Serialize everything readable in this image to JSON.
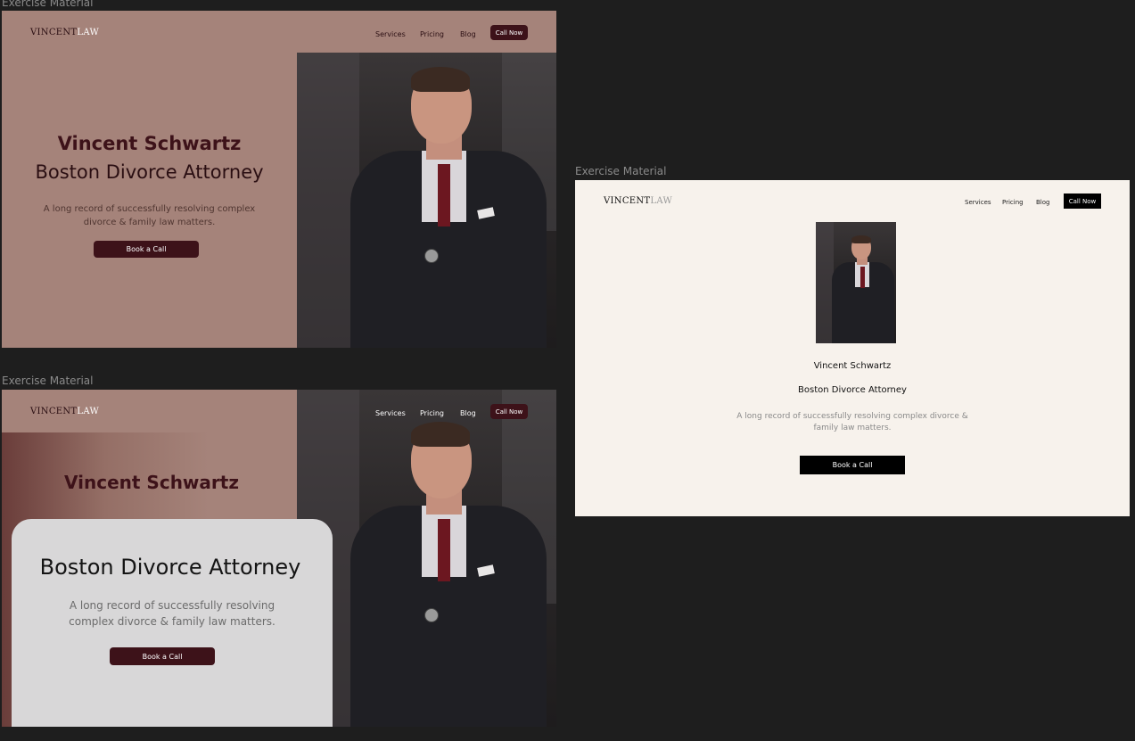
{
  "frames": {
    "f1": {
      "label": "Exercise Material"
    },
    "f2": {
      "label": "Exercise Material"
    },
    "f3": {
      "label": "Exercise Material"
    }
  },
  "brand": {
    "logo_bold": "VINCENT",
    "logo_light": "LAW"
  },
  "nav": {
    "services": "Services",
    "pricing": "Pricing",
    "blog": "Blog",
    "cta": "Call Now"
  },
  "hero": {
    "name": "Vincent Schwartz",
    "title": "Boston Divorce Attorney",
    "tagline": "A long record of successfully resolving complex divorce & family law matters.",
    "tagline_line1": "A long record of successfully resolving complex",
    "tagline_line2": "divorce & family law matters.",
    "tagline_b_line1": "A long record of successfully resolving",
    "tagline_b_line2": "complex divorce & family law matters.",
    "tagline_c_line1": "A long record of successfully resolving complex divorce &",
    "tagline_c_line2": "family law matters.",
    "button": "Book a Call"
  },
  "colors": {
    "canvas": "#1e1e1e",
    "tan": "#a5837a",
    "maroon": "#3d1219",
    "cream": "#f7f2ec",
    "card": "#d8d7d8"
  }
}
